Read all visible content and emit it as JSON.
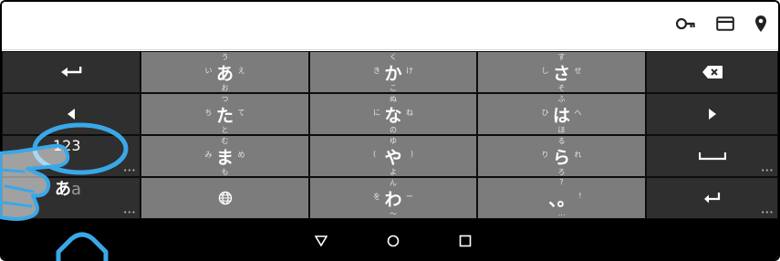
{
  "topbar": {
    "icons": [
      "key-icon",
      "card-icon",
      "location-pin-icon"
    ]
  },
  "keyboard": {
    "left_keys": {
      "undo": "back-arrow-icon",
      "cursor_left": "triangle-left-icon",
      "mode_123": "123",
      "mode_kana_main": "あ",
      "mode_kana_alt": "a"
    },
    "kana_rows": [
      [
        {
          "center": "あ",
          "up": "う",
          "down": "お",
          "left": "い",
          "right": "え"
        },
        {
          "center": "か",
          "up": "く",
          "down": "こ",
          "left": "き",
          "right": "け"
        },
        {
          "center": "さ",
          "up": "す",
          "down": "そ",
          "left": "し",
          "right": "せ"
        }
      ],
      [
        {
          "center": "た",
          "up": "つ",
          "down": "と",
          "left": "ち",
          "right": "て"
        },
        {
          "center": "な",
          "up": "ぬ",
          "down": "の",
          "left": "に",
          "right": "ね"
        },
        {
          "center": "は",
          "up": "ふ",
          "down": "ほ",
          "left": "ひ",
          "right": "へ"
        }
      ],
      [
        {
          "center": "ま",
          "up": "む",
          "down": "も",
          "left": "み",
          "right": "め"
        },
        {
          "center": "や",
          "up": "ゆ",
          "down": "よ",
          "left": "(",
          "right": ")"
        },
        {
          "center": "ら",
          "up": "る",
          "down": "ろ",
          "left": "り",
          "right": "れ"
        }
      ],
      [
        {
          "center": "",
          "up": "",
          "down": "",
          "left": "",
          "right": ""
        },
        {
          "center": "わ",
          "up": "ん",
          "down": "〜",
          "left": "を",
          "right": "ー"
        },
        {
          "center": "、。",
          "up": "?",
          "down": "…",
          "left": "",
          "right": "!"
        }
      ]
    ],
    "right_keys": {
      "backspace": "backspace-icon",
      "cursor_right": "triangle-right-icon",
      "space": "space-icon",
      "enter": "enter-icon"
    }
  },
  "navbar": {
    "buttons": [
      "back-triangle-icon",
      "home-circle-icon",
      "recents-square-icon"
    ]
  },
  "colors": {
    "dark_key": "#2f2f2f",
    "light_key": "#7c7c7c",
    "keyboard_bg": "#121212",
    "nav_bg": "#000000",
    "annotation": "#3aa8e8"
  }
}
